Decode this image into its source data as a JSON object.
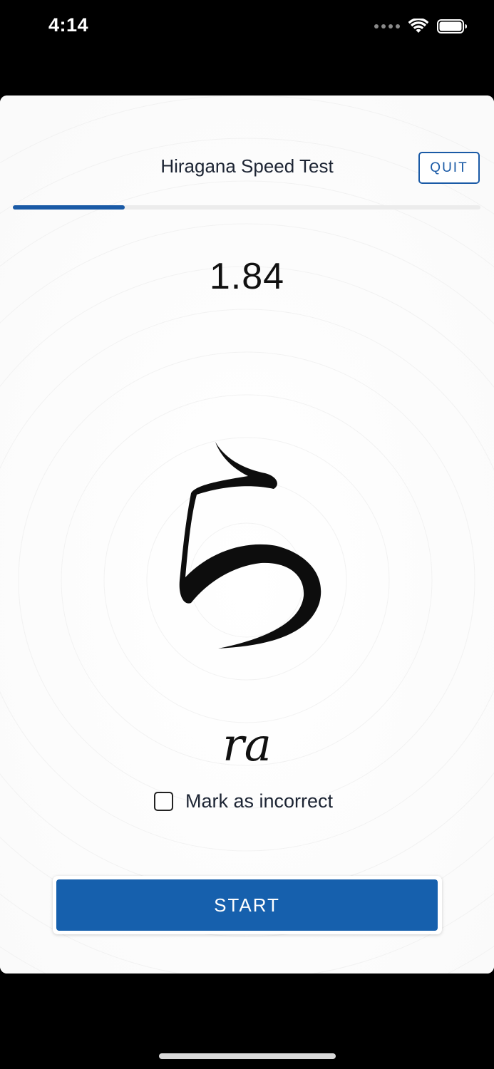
{
  "status_bar": {
    "time": "4:14",
    "icons": [
      "signal-dots-icon",
      "wifi-icon",
      "battery-icon"
    ]
  },
  "header": {
    "title": "Hiragana Speed Test",
    "quit_label": "QUIT"
  },
  "progress": {
    "fraction": 0.24,
    "accent_color": "#1a5aa6"
  },
  "timer": {
    "value": "1.84"
  },
  "card": {
    "kana": "ら",
    "romaji": "ra",
    "mark_label": "Mark as incorrect",
    "mark_checked": false
  },
  "actions": {
    "start_label": "START",
    "button_color": "#1660ad"
  }
}
